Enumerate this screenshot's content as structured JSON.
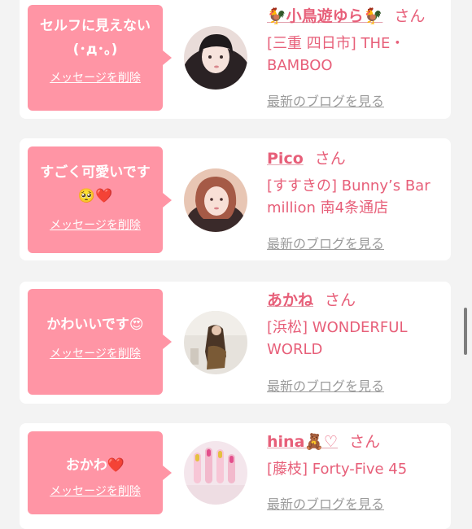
{
  "delete_label": "メッセージを削除",
  "blog_label": "最新のブログを見る",
  "san_label": "さん",
  "colors": {
    "bubble": "#ff95a5",
    "name": "#e75f79",
    "link_gray": "#9b9b9b",
    "background": "#f3f3f3"
  },
  "cards": [
    {
      "message": "セルフに見えない\n(･д･｡)",
      "name": "🐓小鳥遊ゆら🐓",
      "shop": "[三重 四日市] THE・BAMBOO"
    },
    {
      "message": "すごく可愛いです\n🥺❤️",
      "name": "Pico",
      "shop": "[すすきの] Bunny’s Bar million 南4条通店"
    },
    {
      "message": "かわいいです😍",
      "name": "あかね",
      "shop": "[浜松] WONDERFUL WORLD"
    },
    {
      "message": "おかわ❤️",
      "name": "hina🧸♡",
      "shop": "[藤枝] Forty-Five 45"
    }
  ]
}
